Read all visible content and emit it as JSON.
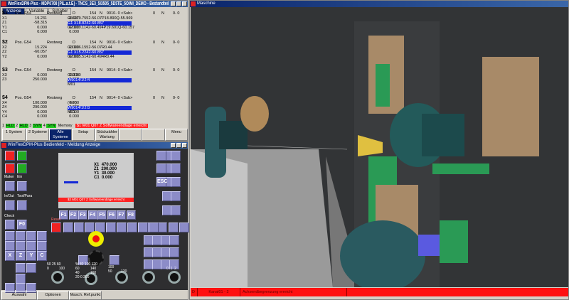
{
  "top_window": {
    "title": "WinFlexDPM-Plus - MDP0708 [PIL.a.t.E] - TNCS_3E3_5I3505_5D5TE_5OIMI_DEMO - Bestandteil",
    "tabs": [
      "Anzeige",
      "Variable",
      "Schalter"
    ],
    "channels": [
      {
        "id": "$1",
        "pos": "Pos. G54",
        "rest": "Restweg",
        "d": "D",
        "n": "154",
        "nl": "N",
        "blk": "9010-  0  <Sub>",
        "r1": "0",
        "r2": "N",
        "r3": "0-  0",
        "axes": [
          [
            "X1",
            "19.231",
            "-8.407"
          ],
          [
            "Z1",
            "-58.315",
            "-1.742"
          ],
          [
            "Y1",
            "0.000",
            "0.000"
          ],
          [
            "C1",
            "0.000",
            "0.000"
          ]
        ],
        "nc": [
          "G3 X19.7552-56.07P18.890Q-55.969",
          "G1 X18.8242-60.857",
          "G2 X19.1142-60.494P19.601Q-60.157"
        ]
      },
      {
        "id": "$2",
        "pos": "Pos. G54",
        "rest": "Restweg",
        "d": "D",
        "n": "154",
        "nl": "N",
        "blk": "9010-  0  <Sub>",
        "r1": "0",
        "r2": "N",
        "r3": "0-  0",
        "axes": [
          [
            "X2",
            "15.224",
            "0.000"
          ],
          [
            "Z2",
            "-60.057",
            "0.000"
          ],
          [
            "Y2",
            "0.000",
            "0.000"
          ]
        ],
        "nc": [
          "G3 X16.1552-56.07R0.44",
          "G1 X15.2242-60.857",
          "G2 X15.5142-60.494R0.44"
        ]
      },
      {
        "id": "$3",
        "pos": "Pos. G54",
        "rest": "Restweg",
        "d": "D",
        "n": "154",
        "nl": "N",
        "blk": "9014-  0  <Sub>",
        "r1": "0",
        "r2": "N",
        "r3": "0-  0",
        "axes": [
          [
            "X3",
            "0.000",
            "0.000"
          ],
          [
            "Z3",
            "250.000",
            "0.000"
          ]
        ],
        "nc": [
          "G53 X0",
          "W9014!1!2!4",
          "M01"
        ]
      },
      {
        "id": "$4",
        "pos": "Pos. G54",
        "rest": "Restweg",
        "d": "D",
        "n": "154",
        "nl": "N",
        "blk": "9014-  0  <Sub>",
        "r1": "0",
        "r2": "N",
        "r3": "0-  0",
        "axes": [
          [
            "X4",
            "100.000",
            "0.000"
          ],
          [
            "Z4",
            "290.000",
            "0.000"
          ],
          [
            "Y4",
            "0.000",
            "0.000"
          ],
          [
            "C4",
            "0.000",
            "0.000"
          ]
        ],
        "nc": [
          "( ## )",
          "W9014!1!2!3",
          "M01"
        ]
      }
    ],
    "status": {
      "s1": "1",
      "s1v": "HLD",
      "s2": "2",
      "s2v": "HLD",
      "s3": "3",
      "s3v": "SYN",
      "s4": "4",
      "s4v": "SYN",
      "mode": "Memory",
      "alarm": "$1 M01 Q07 Z Softwareendlage erreicht"
    },
    "softkeys": [
      "1 System",
      "2 Systeme",
      "Alle Systeme",
      "Setup",
      "Stückzähler Wartung",
      "",
      "",
      "Menu"
    ]
  },
  "panel_window": {
    "title": "WinFlexDPM-Plus Bedienfeld - Meldung Anzeige",
    "mini_screen": {
      "axes": [
        [
          "X1",
          "470.000"
        ],
        [
          "Z1",
          "200.000"
        ],
        [
          "Y1",
          "30.000"
        ],
        [
          "C1",
          "0.000"
        ]
      ],
      "alarm": "$2 M01 Q07 Z Softwareendlage erreicht"
    },
    "fkeys": [
      "F1",
      "F2",
      "F3",
      "F4",
      "F5",
      "F6",
      "F7",
      "F8"
    ],
    "left_labels": [
      "Maker",
      "Ein",
      "In/Out",
      "Tool/Para",
      "Check"
    ],
    "f0": "F0",
    "axis_keys": [
      "X",
      "Z",
      "Y",
      "C"
    ],
    "esc": "ESC",
    "reset": "Reset",
    "override_scales": {
      "spindle": [
        "50",
        "25",
        "60",
        "0",
        "100"
      ],
      "feed": [
        "%",
        "80",
        "100",
        "120",
        "60",
        "140",
        "40",
        "160",
        "20",
        "200",
        "0"
      ],
      "rapid": [
        "50",
        "100",
        "120"
      ],
      "jog": [
        "0",
        "1",
        "2"
      ]
    },
    "buttons": [
      "Auswahl",
      "Optionen",
      "Masch. Ref.punkt"
    ]
  },
  "machine_window": {
    "title": "Maschine",
    "status": [
      "D",
      "Kanal01 - 2",
      "Achsendbegrenzung erreicht"
    ]
  },
  "colors": {
    "highlight": "#1428d6",
    "alarm": "#ff1010",
    "panel": "#2e2e30",
    "key": "#8c8cc8"
  }
}
